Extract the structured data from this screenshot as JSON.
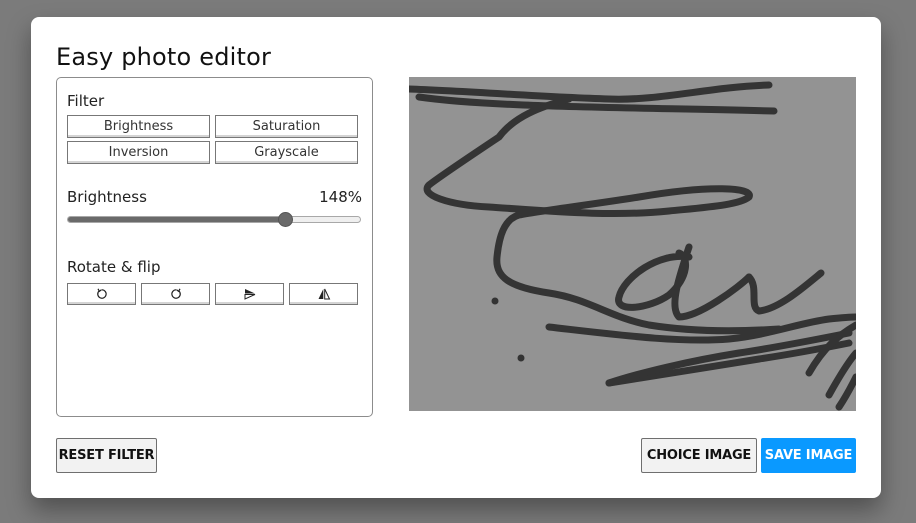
{
  "app": {
    "title": "Easy photo editor"
  },
  "filter": {
    "heading": "Filter",
    "options": [
      "Brightness",
      "Saturation",
      "Inversion",
      "Grayscale"
    ]
  },
  "slider": {
    "label": "Brightness",
    "value_text": "148%",
    "level_fraction": 0.74
  },
  "rotate_flip": {
    "heading": "Rotate & flip",
    "buttons": [
      {
        "icon": "rotate-left-icon"
      },
      {
        "icon": "rotate-right-icon"
      },
      {
        "icon": "flip-horizontal-icon"
      },
      {
        "icon": "flip-vertical-icon"
      }
    ]
  },
  "actions": {
    "reset": "RESET FILTER",
    "choose": "CHOICE IMAGE",
    "save": "SAVE IMAGE"
  },
  "colors": {
    "primary": "#0a99ff",
    "preview_bg": "#939393",
    "stroke": "#333333"
  }
}
